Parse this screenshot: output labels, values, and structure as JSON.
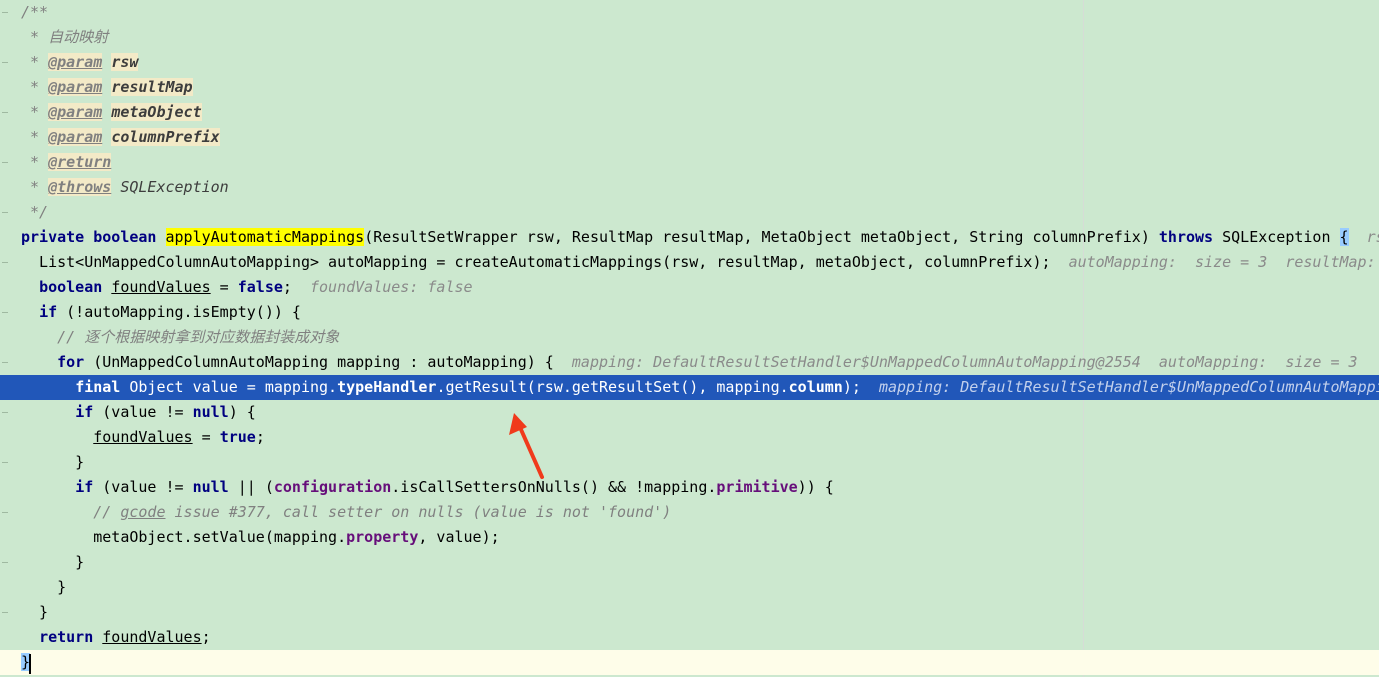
{
  "editor": {
    "lines": [
      {
        "tokens": [
          {
            "t": "/**",
            "c": "c-comment"
          }
        ]
      },
      {
        "tokens": [
          {
            "t": " * 自动映射",
            "c": "c-comment"
          }
        ]
      },
      {
        "tokens": [
          {
            "t": " * ",
            "c": "c-comment"
          },
          {
            "t": "@param",
            "c": "c-tag"
          },
          {
            "t": " ",
            "c": "c-comment"
          },
          {
            "t": "rsw",
            "c": "c-tagval"
          }
        ]
      },
      {
        "tokens": [
          {
            "t": " * ",
            "c": "c-comment"
          },
          {
            "t": "@param",
            "c": "c-tag"
          },
          {
            "t": " ",
            "c": "c-comment"
          },
          {
            "t": "resultMap",
            "c": "c-tagval"
          }
        ]
      },
      {
        "tokens": [
          {
            "t": " * ",
            "c": "c-comment"
          },
          {
            "t": "@param",
            "c": "c-tag"
          },
          {
            "t": " ",
            "c": "c-comment"
          },
          {
            "t": "metaObject",
            "c": "c-tagval"
          }
        ]
      },
      {
        "tokens": [
          {
            "t": " * ",
            "c": "c-comment"
          },
          {
            "t": "@param",
            "c": "c-tag"
          },
          {
            "t": " ",
            "c": "c-comment"
          },
          {
            "t": "columnPrefix",
            "c": "c-tagval"
          }
        ]
      },
      {
        "tokens": [
          {
            "t": " * ",
            "c": "c-comment"
          },
          {
            "t": "@return",
            "c": "c-tag"
          }
        ]
      },
      {
        "tokens": [
          {
            "t": " * ",
            "c": "c-comment"
          },
          {
            "t": "@throws",
            "c": "c-tag"
          },
          {
            "t": " SQLException",
            "c": "c-tagplain"
          }
        ]
      },
      {
        "tokens": [
          {
            "t": " */",
            "c": "c-comment"
          }
        ]
      },
      {
        "tokens": [
          {
            "t": "private boolean ",
            "c": "c-kw"
          },
          {
            "t": "applyAutomaticMappings",
            "c": "c-plain c-hl"
          },
          {
            "t": "(ResultSetWrapper rsw, ResultMap resultMap, MetaObject metaObject, String columnPrefix) ",
            "c": "c-plain"
          },
          {
            "t": "throws ",
            "c": "c-kw"
          },
          {
            "t": "SQLException ",
            "c": "c-plain"
          },
          {
            "t": "{",
            "c": "c-plain c-brace-hl"
          },
          {
            "t": "  rsw:",
            "c": "c-hint"
          }
        ]
      },
      {
        "tokens": [
          {
            "t": "  List<UnMappedColumnAutoMapping> autoMapping = createAutomaticMappings(rsw, resultMap, metaObject, columnPrefix);",
            "c": "c-plain"
          },
          {
            "t": "  autoMapping:  size = 3  resultMap:",
            "c": "c-hint"
          }
        ]
      },
      {
        "tokens": [
          {
            "t": "  ",
            "c": "c-plain"
          },
          {
            "t": "boolean ",
            "c": "c-kw"
          },
          {
            "t": "foundValues",
            "c": "c-plain c-ul"
          },
          {
            "t": " = ",
            "c": "c-plain"
          },
          {
            "t": "false",
            "c": "c-kw"
          },
          {
            "t": ";",
            "c": "c-plain"
          },
          {
            "t": "  foundValues: false",
            "c": "c-hint"
          }
        ]
      },
      {
        "tokens": [
          {
            "t": "  ",
            "c": "c-plain"
          },
          {
            "t": "if ",
            "c": "c-kw"
          },
          {
            "t": "(!autoMapping.isEmpty()) {",
            "c": "c-plain"
          }
        ]
      },
      {
        "tokens": [
          {
            "t": "    // 逐个根据映射拿到对应数据封装成对象",
            "c": "c-comment"
          }
        ]
      },
      {
        "tokens": [
          {
            "t": "    ",
            "c": "c-plain"
          },
          {
            "t": "for ",
            "c": "c-kw"
          },
          {
            "t": "(UnMappedColumnAutoMapping mapping : autoMapping) {",
            "c": "c-plain"
          },
          {
            "t": "  mapping: DefaultResultSetHandler$UnMappedColumnAutoMapping@2554  autoMapping:  size = 3",
            "c": "c-hint"
          }
        ]
      },
      {
        "current": true,
        "tokens": [
          {
            "t": "      ",
            "c": "c-plain"
          },
          {
            "t": "final ",
            "c": "c-kw"
          },
          {
            "t": "Object value = mapping.",
            "c": "c-plain"
          },
          {
            "t": "typeHandler",
            "c": "c-field"
          },
          {
            "t": ".getResult(rsw.getResultSet(), mapping.",
            "c": "c-plain"
          },
          {
            "t": "column",
            "c": "c-field"
          },
          {
            "t": ");",
            "c": "c-plain"
          },
          {
            "t": "  mapping: DefaultResultSetHandler$UnMappedColumnAutoMappi",
            "c": "c-hint"
          }
        ]
      },
      {
        "tokens": [
          {
            "t": "      ",
            "c": "c-plain"
          },
          {
            "t": "if ",
            "c": "c-kw"
          },
          {
            "t": "(value != ",
            "c": "c-plain"
          },
          {
            "t": "null",
            "c": "c-kw"
          },
          {
            "t": ") {",
            "c": "c-plain"
          }
        ]
      },
      {
        "tokens": [
          {
            "t": "        ",
            "c": "c-plain"
          },
          {
            "t": "foundValues",
            "c": "c-plain c-ul"
          },
          {
            "t": " = ",
            "c": "c-plain"
          },
          {
            "t": "true",
            "c": "c-kw"
          },
          {
            "t": ";",
            "c": "c-plain"
          }
        ]
      },
      {
        "tokens": [
          {
            "t": "      }",
            "c": "c-plain"
          }
        ]
      },
      {
        "tokens": [
          {
            "t": "      ",
            "c": "c-plain"
          },
          {
            "t": "if ",
            "c": "c-kw"
          },
          {
            "t": "(value != ",
            "c": "c-plain"
          },
          {
            "t": "null ",
            "c": "c-kw"
          },
          {
            "t": "|| (",
            "c": "c-plain"
          },
          {
            "t": "configuration",
            "c": "c-field"
          },
          {
            "t": ".isCallSettersOnNulls() && !mapping.",
            "c": "c-plain"
          },
          {
            "t": "primitive",
            "c": "c-field"
          },
          {
            "t": ")) {",
            "c": "c-plain"
          }
        ]
      },
      {
        "tokens": [
          {
            "t": "        // ",
            "c": "c-comment"
          },
          {
            "t": "gcode",
            "c": "c-comment c-ul"
          },
          {
            "t": " issue #377, call setter on nulls (value is not 'found')",
            "c": "c-comment"
          }
        ]
      },
      {
        "tokens": [
          {
            "t": "        metaObject.setValue(mapping.",
            "c": "c-plain"
          },
          {
            "t": "property",
            "c": "c-field"
          },
          {
            "t": ", value);",
            "c": "c-plain"
          }
        ]
      },
      {
        "tokens": [
          {
            "t": "      }",
            "c": "c-plain"
          }
        ]
      },
      {
        "tokens": [
          {
            "t": "    }",
            "c": "c-plain"
          }
        ]
      },
      {
        "tokens": [
          {
            "t": "  }",
            "c": "c-plain"
          }
        ]
      },
      {
        "tokens": [
          {
            "t": "  ",
            "c": "c-plain"
          },
          {
            "t": "return ",
            "c": "c-kw"
          },
          {
            "t": "foundValues",
            "c": "c-plain c-ul"
          },
          {
            "t": ";",
            "c": "c-plain"
          }
        ]
      },
      {
        "last": true,
        "tokens": [
          {
            "t": "}",
            "c": "c-plain c-brace-hl"
          }
        ]
      }
    ]
  },
  "annotation": {
    "icon": "red-arrow",
    "color": "#f03a1c"
  },
  "colors": {
    "background": "#cce8cf",
    "current_line": "#2157b9",
    "keyword": "#000080",
    "field": "#660e7a",
    "comment": "#808080",
    "hint": "#8a8a8a",
    "method_highlight": "#ffff00"
  }
}
